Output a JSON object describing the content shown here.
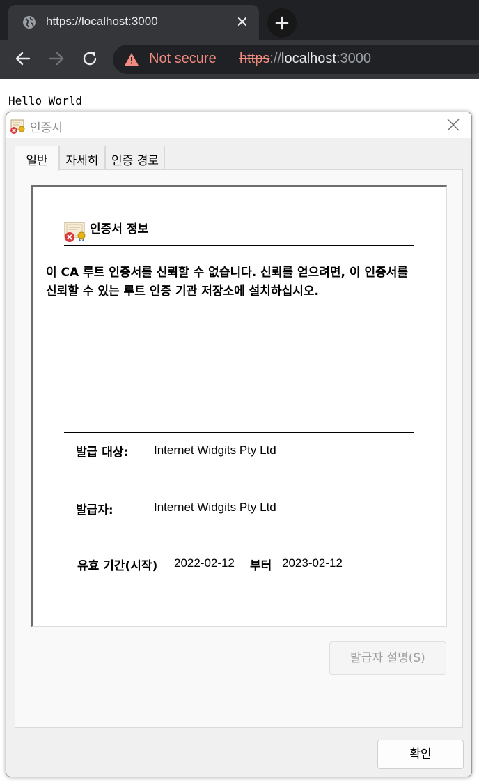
{
  "browser": {
    "tab_title": "https://localhost:3000",
    "security_label": "Not secure",
    "url": {
      "scheme": "https",
      "slashes": "://",
      "host": "localhost",
      "port": ":3000"
    }
  },
  "page": {
    "body_text": "Hello World"
  },
  "dialog": {
    "title": "인증서",
    "tabs": [
      "일반",
      "자세히",
      "인증 경로"
    ],
    "active_tab": "일반",
    "info_title": "인증서 정보",
    "warning": "이 CA 루트 인증서를 신뢰할 수 없습니다. 신뢰를 얻으려면, 이 인증서를 신뢰할 수 있는 루트 인증 기관 저장소에 설치하십시오.",
    "issued_to_label": "발급 대상:",
    "issued_to": "Internet Widgits Pty Ltd",
    "issued_by_label": "발급자:",
    "issued_by": "Internet Widgits Pty Ltd",
    "validity_label": "유효 기간(시작)",
    "valid_from": "2022-02-12",
    "to_label": "부터",
    "valid_to": "2023-02-12",
    "issuer_statement_button": "발급자 설명(S)",
    "ok_button": "확인"
  }
}
